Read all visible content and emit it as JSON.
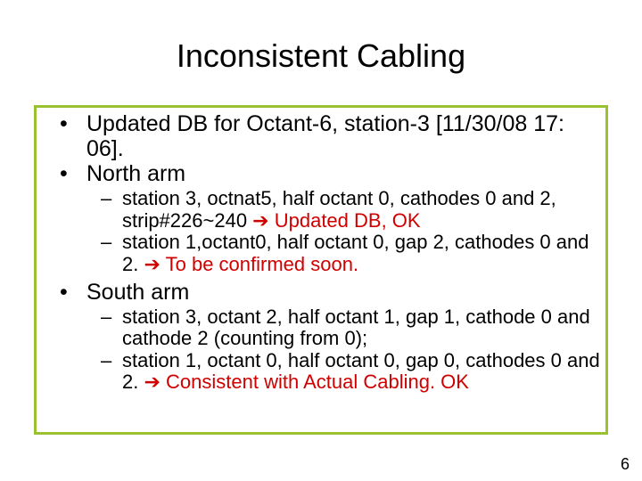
{
  "title": "Inconsistent Cabling",
  "bullets": {
    "b1": "Updated DB for Octant-6, station-3 [11/30/08 17: 06].",
    "b2": "North arm",
    "b2_sub1_a": "station 3, octnat5, half octant 0, cathodes 0 and 2, strip#226~240 ",
    "b2_sub1_b": " Updated DB, OK",
    "b2_sub2_a": "station 1,octant0, half octant 0, gap 2, cathodes 0 and 2. ",
    "b2_sub2_b": " To be confirmed soon.",
    "b3": "South arm",
    "b3_sub1": "station 3, octant 2, half octant 1, gap 1, cathode 0 and cathode 2 (counting from 0);",
    "b3_sub2_a": "station 1, octant 0, half octant 0, gap 0, cathodes 0 and 2. ",
    "b3_sub2_b": " Consistent with Actual Cabling. OK"
  },
  "arrow": "➔",
  "page_number": "6"
}
